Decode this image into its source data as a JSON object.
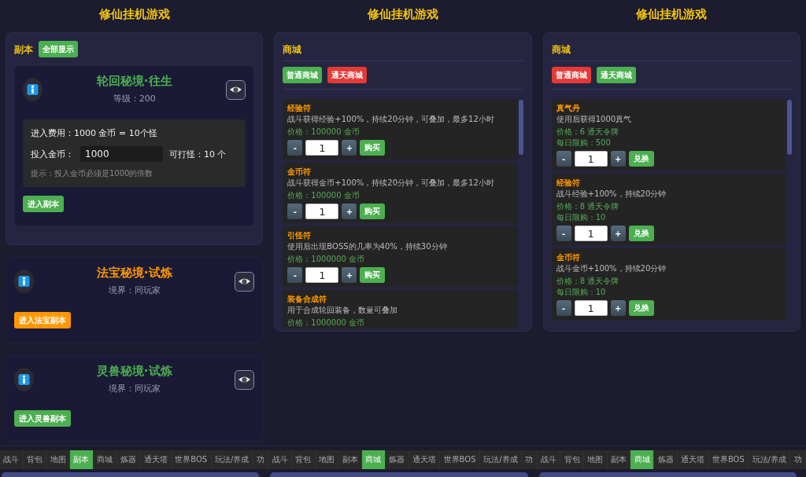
{
  "screens": [
    {
      "kind": "dungeons",
      "title": "修仙挂机游戏",
      "panel": {
        "header": "副本",
        "show_all_button": "全部显示",
        "dungeons": [
          {
            "name": "轮回秘境·往生",
            "color": "#4caf50",
            "requirement": "等级：200",
            "cost": {
              "summary": "进入费用：1000 金币 = 10个怪",
              "input_label": "投入金币：",
              "input_value": "1000",
              "result": "可打怪：10 个",
              "hint": "提示：投入金币必须是1000的倍数"
            },
            "enter_button": "进入副本"
          }
        ]
      },
      "dungeons": [
        {
          "name": "法宝秘境·试炼",
          "color": "#ff9800",
          "requirement": "境界：同玩家",
          "enter_button": "进入法宝副本"
        },
        {
          "name": "灵兽秘境·试炼",
          "color": "#4caf50",
          "requirement": "境界：同玩家",
          "enter_button": "进入灵兽副本"
        }
      ],
      "nav": [
        {
          "label": "战斗",
          "selected": false
        },
        {
          "label": "背包",
          "selected": false
        },
        {
          "label": "地图",
          "selected": false
        },
        {
          "label": "副本",
          "selected": true
        },
        {
          "label": "商城",
          "selected": false
        },
        {
          "label": "炼器",
          "selected": false
        },
        {
          "label": "通天塔",
          "selected": false
        },
        {
          "label": "世界BOS",
          "selected": false
        },
        {
          "label": "玩法/养成",
          "selected": false
        },
        {
          "label": "功",
          "selected": false
        }
      ]
    },
    {
      "kind": "shop",
      "title": "修仙挂机游戏",
      "panel": {
        "header": "商城",
        "tabs": [
          {
            "label": "普通商城",
            "selected": true
          },
          {
            "label": "通天商城",
            "selected": false
          }
        ],
        "items": [
          {
            "name": "经验符",
            "description": "战斗获得经验+100%，持续20分钟，可叠加，最多12小时",
            "price": "价格：100000 金币",
            "decrease": "-",
            "quantity": "1",
            "increase": "+",
            "buy_button": "购买"
          },
          {
            "name": "金币符",
            "description": "战斗获得金币+100%，持续20分钟，可叠加，最多12小时",
            "price": "价格：100000 金币",
            "decrease": "-",
            "quantity": "1",
            "increase": "+",
            "buy_button": "购买"
          },
          {
            "name": "引怪符",
            "description": "使用后出现BOSS的几率为40%，持续30分钟",
            "price": "价格：1000000 金币",
            "decrease": "-",
            "quantity": "1",
            "increase": "+",
            "buy_button": "购买"
          },
          {
            "name": "装备合成符",
            "description": "用于合成轮回装备，数量可叠加",
            "price": "价格：1000000 金币"
          }
        ]
      },
      "nav": [
        {
          "label": "战斗",
          "selected": false
        },
        {
          "label": "背包",
          "selected": false
        },
        {
          "label": "地图",
          "selected": false
        },
        {
          "label": "副本",
          "selected": false
        },
        {
          "label": "商城",
          "selected": true
        },
        {
          "label": "炼器",
          "selected": false
        },
        {
          "label": "通天塔",
          "selected": false
        },
        {
          "label": "世界BOS",
          "selected": false
        },
        {
          "label": "玩法/养成",
          "selected": false
        },
        {
          "label": "功",
          "selected": false
        }
      ]
    },
    {
      "kind": "shop",
      "title": "修仙挂机游戏",
      "panel": {
        "header": "商城",
        "tabs": [
          {
            "label": "普通商城",
            "selected": false
          },
          {
            "label": "通天商城",
            "selected": true
          }
        ],
        "items": [
          {
            "name": "真气丹",
            "description": "使用后获得1000真气",
            "price": "价格：6 通天令牌",
            "limit": "每日限购：500",
            "decrease": "-",
            "quantity": "1",
            "increase": "+",
            "buy_button": "兑换"
          },
          {
            "name": "经验符",
            "description": "战斗经验+100%，持续20分钟",
            "price": "价格：8 通天令牌",
            "limit": "每日限购：10",
            "decrease": "-",
            "quantity": "1",
            "increase": "+",
            "buy_button": "兑换"
          },
          {
            "name": "金币符",
            "description": "战斗金币+100%，持续20分钟",
            "price": "价格：8 通天令牌",
            "limit": "每日限购：10",
            "decrease": "-",
            "quantity": "1",
            "increase": "+",
            "buy_button": "兑换"
          }
        ]
      },
      "nav": [
        {
          "label": "战斗",
          "selected": false
        },
        {
          "label": "背包",
          "selected": false
        },
        {
          "label": "地图",
          "selected": false
        },
        {
          "label": "副本",
          "selected": false
        },
        {
          "label": "商城",
          "selected": true
        },
        {
          "label": "炼器",
          "selected": false
        },
        {
          "label": "通天塔",
          "selected": false
        },
        {
          "label": "世界BOS",
          "selected": false
        },
        {
          "label": "玩法/养成",
          "selected": false
        },
        {
          "label": "功",
          "selected": false
        }
      ]
    }
  ]
}
